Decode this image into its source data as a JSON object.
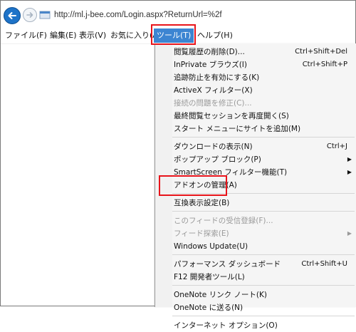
{
  "browser": {
    "url": "http://ml.j-bee.com/Login.aspx?ReturnUrl=%2f"
  },
  "menubar": {
    "items": [
      {
        "label": "ファイル(F)"
      },
      {
        "label": "編集(E)"
      },
      {
        "label": "表示(V)"
      },
      {
        "label": "お気に入り(A)"
      },
      {
        "label": "ツール(T)"
      },
      {
        "label": "ヘルプ(H)"
      }
    ],
    "active_item": "ツール(T)"
  },
  "tools_menu": {
    "groups": [
      [
        {
          "label": "閲覧履歴の削除(D)...",
          "shortcut": "Ctrl+Shift+Del"
        },
        {
          "label": "InPrivate ブラウズ(I)",
          "shortcut": "Ctrl+Shift+P"
        },
        {
          "label": "追跡防止を有効にする(K)"
        },
        {
          "label": "ActiveX フィルター(X)"
        },
        {
          "label": "接続の問題を修正(C)...",
          "disabled": true
        },
        {
          "label": "最終閲覧セッションを再度開く(S)"
        },
        {
          "label": "スタート メニューにサイトを追加(M)"
        }
      ],
      [
        {
          "label": "ダウンロードの表示(N)",
          "shortcut": "Ctrl+J"
        },
        {
          "label": "ポップアップ ブロック(P)",
          "submenu": true
        },
        {
          "label": "SmartScreen フィルター機能(T)",
          "submenu": true
        },
        {
          "label": "アドオンの管理(A)"
        }
      ],
      [
        {
          "label": "互換表示設定(B)"
        }
      ],
      [
        {
          "label": "このフィードの受信登録(F)...",
          "disabled": true
        },
        {
          "label": "フィード探索(E)",
          "disabled": true,
          "submenu": true
        },
        {
          "label": "Windows Update(U)"
        }
      ],
      [
        {
          "label": "パフォーマンス ダッシュボード",
          "shortcut": "Ctrl+Shift+U"
        },
        {
          "label": "F12 開発者ツール(L)"
        }
      ],
      [
        {
          "label": "OneNote リンク ノート(K)"
        },
        {
          "label": "OneNote に送る(N)"
        }
      ],
      [
        {
          "label": "インターネット オプション(O)"
        }
      ]
    ]
  },
  "colors": {
    "highlight": "#3c85d2",
    "callout": "#e8141b",
    "menu_bg": "#f5f5f5",
    "disabled_text": "#9a9a9a"
  },
  "icons": {
    "back": "back-arrow-icon",
    "forward": "forward-arrow-icon",
    "page": "ie-page-icon",
    "submenu": "chevron-right-icon"
  }
}
